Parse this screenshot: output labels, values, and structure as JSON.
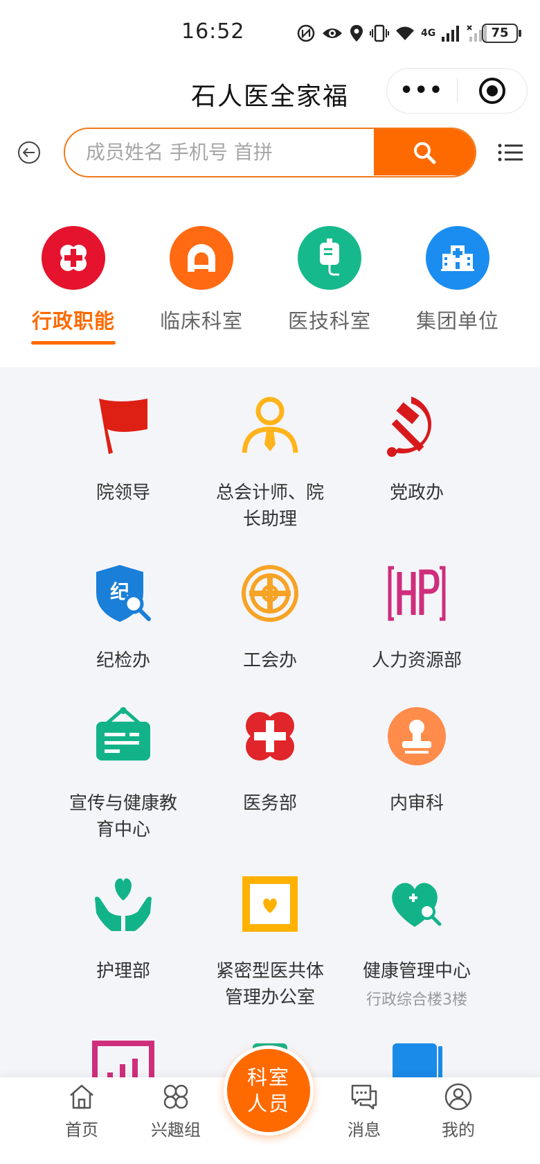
{
  "status_bar": {
    "time": "16:52",
    "network": "4G",
    "battery": "75"
  },
  "title_bar": {
    "title": "石人医全家福",
    "more_icon": "more-dots-icon",
    "close_icon": "target-icon"
  },
  "search": {
    "placeholder": "成员姓名 手机号 首拼",
    "value": "",
    "button_icon": "search-icon"
  },
  "categories": [
    {
      "label": "行政职能",
      "icon": "red-cross-icon",
      "color": "#e5132d",
      "active": true
    },
    {
      "label": "临床科室",
      "icon": "ct-scanner-icon",
      "color": "#ff6a12",
      "active": false
    },
    {
      "label": "医技科室",
      "icon": "iv-bag-icon",
      "color": "#16b98c",
      "active": false
    },
    {
      "label": "集团单位",
      "icon": "hospital-building-icon",
      "color": "#1b8df0",
      "active": false
    }
  ],
  "departments": [
    {
      "name": "院领导",
      "icon": "red-flag-icon"
    },
    {
      "name": "总会计师、院长助理",
      "icon": "person-tie-icon"
    },
    {
      "name": "党政办",
      "icon": "hammer-sickle-icon"
    },
    {
      "name": "纪检办",
      "icon": "shield-search-icon"
    },
    {
      "name": "工会办",
      "icon": "union-emblem-icon"
    },
    {
      "name": "人力资源部",
      "icon": "hr-logo-icon"
    },
    {
      "name": "宣传与健康教育中心",
      "icon": "signboard-icon"
    },
    {
      "name": "医务部",
      "icon": "medical-cross-icon"
    },
    {
      "name": "内审科",
      "icon": "stamp-icon"
    },
    {
      "name": "护理部",
      "icon": "heart-hands-icon"
    },
    {
      "name": "紧密型医共体管理办公室",
      "icon": "heart-box-icon"
    },
    {
      "name": "健康管理中心",
      "icon": "heart-search-icon",
      "location": "行政综合楼3楼"
    },
    {
      "name": "",
      "icon": "bar-chart-icon"
    },
    {
      "name": "",
      "icon": "teal-box-icon"
    },
    {
      "name": "",
      "icon": "blue-book-icon"
    }
  ],
  "bottom_nav": {
    "items": [
      {
        "label": "首页",
        "icon": "home-icon"
      },
      {
        "label": "兴趣组",
        "icon": "clover-icon"
      },
      {
        "label": "消息",
        "icon": "chat-icon"
      },
      {
        "label": "我的",
        "icon": "user-icon"
      }
    ],
    "center_line1": "科室",
    "center_line2": "人员"
  },
  "colors": {
    "accent": "#ff6a00",
    "active_tab": "#ff6a00"
  }
}
